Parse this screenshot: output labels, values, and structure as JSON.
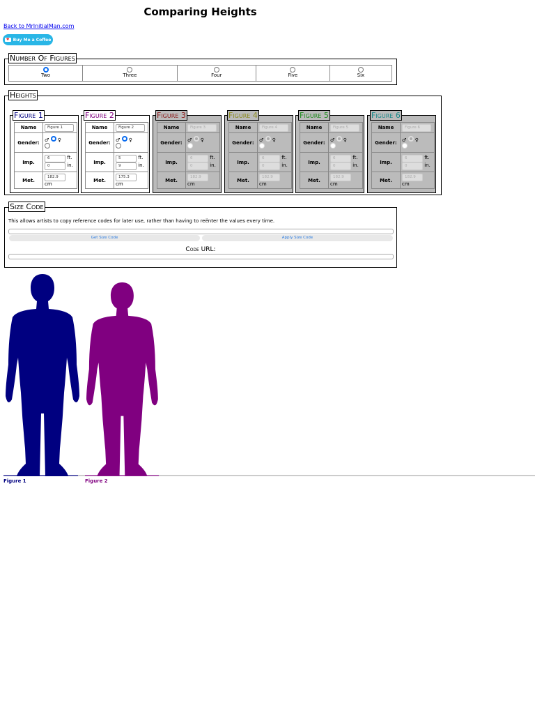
{
  "title": "Comparing Heights",
  "back_link": "Back to MrInitialMan.com",
  "coffee_button": "Buy Me a Coffee",
  "number_of_figures": {
    "legend": "Number Of Figures",
    "options": [
      "Two",
      "Three",
      "Four",
      "Five",
      "Six"
    ],
    "selected": "Two"
  },
  "heights": {
    "legend": "Heights",
    "labels": {
      "name": "Name",
      "gender": "Gender:",
      "imp": "Imp.",
      "met": "Met.",
      "ft": "ft.",
      "in": "in.",
      "cm": "cm",
      "male": "♂",
      "female": "♀"
    },
    "figures": [
      {
        "title": "Figure 1",
        "name": "Figure 1",
        "gender": "male",
        "ft": "6",
        "in": "0",
        "cm": "182.9",
        "color": "#000080",
        "enabled": true
      },
      {
        "title": "Figure 2",
        "name": "Figure 2",
        "gender": "male",
        "ft": "5",
        "in": "9",
        "cm": "175.3",
        "color": "#800080",
        "enabled": true
      },
      {
        "title": "Figure 3",
        "name": "Figure 3",
        "gender": "male",
        "ft": "6",
        "in": "0",
        "cm": "182.9",
        "color": "#8b1a1a",
        "enabled": false
      },
      {
        "title": "Figure 4",
        "name": "Figure 4",
        "gender": "male",
        "ft": "6",
        "in": "0",
        "cm": "182.9",
        "color": "#8a8a1a",
        "enabled": false
      },
      {
        "title": "Figure 5",
        "name": "Figure 5",
        "gender": "male",
        "ft": "6",
        "in": "0",
        "cm": "182.9",
        "color": "#1a8a1a",
        "enabled": false
      },
      {
        "title": "Figure 6",
        "name": "Figure 6",
        "gender": "male",
        "ft": "6",
        "in": "0",
        "cm": "182.9",
        "color": "#1a8a8a",
        "enabled": false
      }
    ]
  },
  "size_code": {
    "legend": "Size Code",
    "description": "This allows artists to copy reference codes for later use, rather than having to reënter the values every time.",
    "get_button": "Get Size Code",
    "apply_button": "Apply Size Code",
    "code_url_label": "Code URL:",
    "code_value": "",
    "url_value": ""
  },
  "display": {
    "labels": [
      "Figure 1",
      "Figure 2"
    ]
  }
}
